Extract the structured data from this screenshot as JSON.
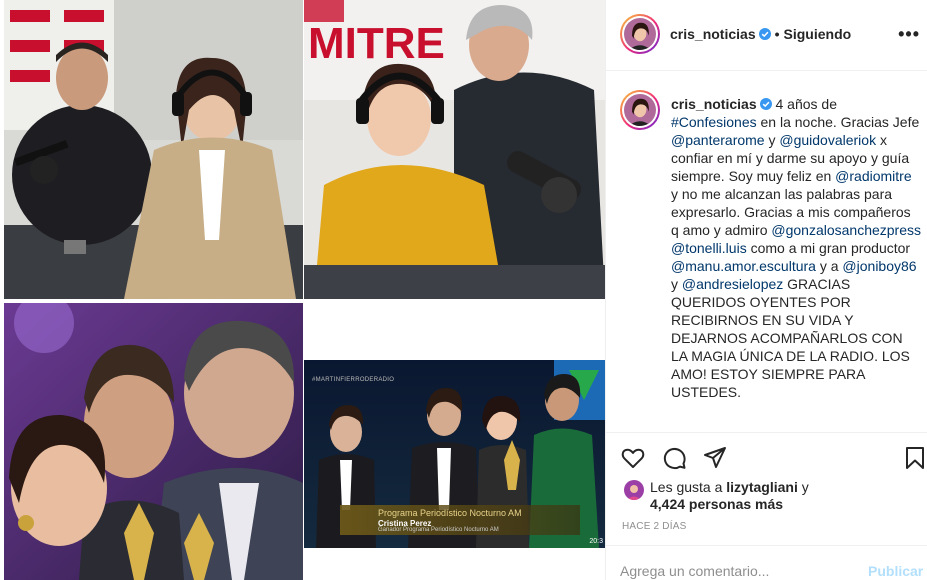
{
  "post": {
    "username": "cris_noticias",
    "separator": "•",
    "follow_status": "Siguiendo",
    "more_glyph": "•••",
    "caption": {
      "username": "cris_noticias",
      "t1": " 4 años de ",
      "hashtag": "#Confesiones",
      "t2": " en la noche. Gracias Jefe ",
      "m1": "@panterarome",
      "t3": " y ",
      "m2": "@guidovaleriok",
      "t4": " x confiar en mí y darme su apoyo y guía siempre. Soy muy feliz en ",
      "m3": "@radiomitre",
      "t5": " y no me alcanzan las palabras para expresarlo. Gracias a mis compañeros q amo y admiro ",
      "m4": "@gonzalosanchezpress",
      "t6": " ",
      "m5": "@tonelli.luis",
      "t7": " como a mi gran productor ",
      "m6": "@manu.amor.escultura",
      "t8": " y a ",
      "m7": "@joniboy86",
      "t9": " y ",
      "m8": "@andresielopez",
      "t10": " GRACIAS QUERIDOS OYENTES POR RECIBIRNOS EN SU VIDA Y DEJARNOS ACOMPAÑARLOS CON LA MAGIA ÚNICA DE LA RADIO. LOS AMO! ESTOY SIEMPRE PARA USTEDES."
    },
    "likes": {
      "prefix": "Les gusta a ",
      "user": "lizytagliani",
      "suffix": " y",
      "count": "4,424 personas más"
    },
    "timestamp": "HACE 2 DÍAS",
    "comment_input": {
      "placeholder": "Agrega un comentario..."
    },
    "publish_label": "Publicar"
  },
  "media": {
    "radio_brand": "MITRE",
    "tv_hashtag": "#MARTINFIERRODERADIO",
    "tv_caption_l1": "Programa Periodístico Nocturno AM",
    "tv_caption_l2": "Cristina Perez",
    "tv_caption_l3": "Ganador Programa Periodístico Nocturno AM",
    "tv_time": "20:3"
  },
  "colors": {
    "link": "#00376b",
    "verified": "#3897f0",
    "muted": "#8e8e8e",
    "publish_disabled": "#b2dffc",
    "divider": "#efefef"
  },
  "icons": [
    "verified-badge-icon",
    "heart-icon",
    "comment-icon",
    "share-icon",
    "bookmark-icon",
    "more-options-icon"
  ]
}
